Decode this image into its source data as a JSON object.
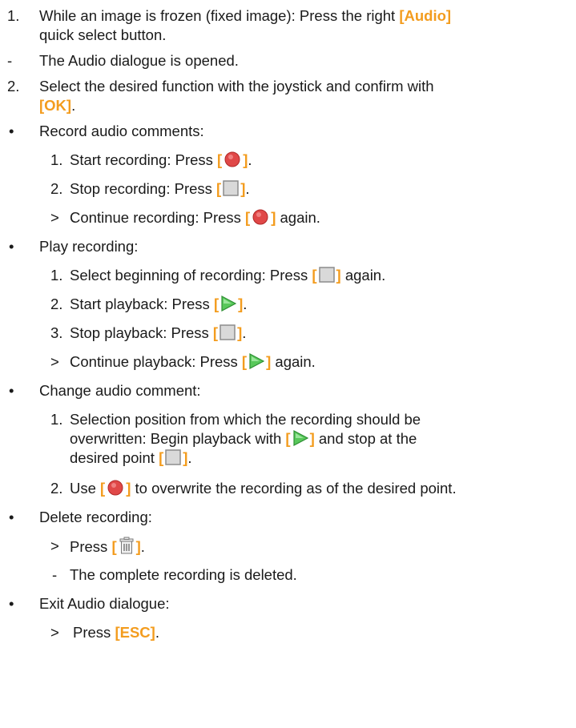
{
  "accent_color": "#f39c1e",
  "steps": {
    "s1_marker": "1.",
    "s1_text": "While an image is frozen (fixed image): Press the right ",
    "s1_key": "[Audio]",
    "s1_cont": "quick select button.",
    "s1_result_marker": "-",
    "s1_result": "The Audio dialogue is opened.",
    "s2_marker": "2.",
    "s2_text": "Select the desired function with the joystick and confirm with",
    "s2_key": "[OK]",
    "s2_end": "."
  },
  "record": {
    "bullet": "•",
    "title": "Record audio comments:",
    "i1_marker": "1.",
    "i1_text": "Start recording: Press ",
    "i2_marker": "2.",
    "i2_text": "Stop recording: Press ",
    "i3_marker": ">",
    "i3_text": "Continue recording: Press ",
    "i3_after": " again."
  },
  "play": {
    "bullet": "•",
    "title": "Play recording:",
    "i1_marker": "1.",
    "i1_text": "Select beginning of recording: Press ",
    "i1_after": " again.",
    "i2_marker": "2.",
    "i2_text": "Start playback: Press ",
    "i3_marker": "3.",
    "i3_text": "Stop playback: Press ",
    "i4_marker": ">",
    "i4_text": "Continue playback: Press ",
    "i4_after": " again."
  },
  "change": {
    "bullet": "•",
    "title": "Change audio comment:",
    "i1_marker": "1.",
    "i1_line1": "Selection position from which the recording should be",
    "i1_line2a": "overwritten: Begin playback with ",
    "i1_line2b": " and stop at the",
    "i1_line3": "desired point ",
    "i2_marker": "2.",
    "i2_a": "Use ",
    "i2_b": " to overwrite the recording as of the desired point."
  },
  "delete": {
    "bullet": "•",
    "title": "Delete recording:",
    "i1_marker": ">",
    "i1_text": "Press ",
    "r_marker": "-",
    "r_text": "The complete recording is deleted."
  },
  "exit": {
    "bullet": "•",
    "title": "Exit Audio dialogue:",
    "i1_marker": ">",
    "i1_text": "Press ",
    "i1_key": "[ESC]",
    "i1_end": "."
  },
  "key": {
    "open": "[",
    "close": "]",
    "period": "."
  },
  "icons": {
    "record": "record-icon",
    "stop": "stop-icon",
    "play": "play-icon",
    "delete": "trash-icon"
  }
}
